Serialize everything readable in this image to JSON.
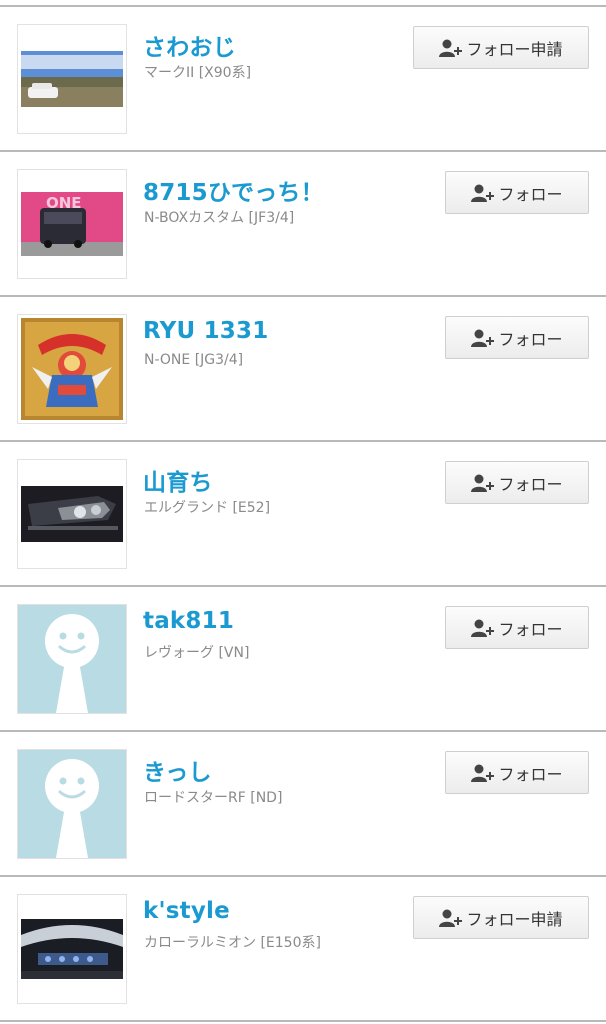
{
  "users": [
    {
      "name": "さわおじ",
      "car": "マークII [X90系]",
      "button": "フォロー申請",
      "avatar_icon": "car-photo-icon"
    },
    {
      "name": "8715ひでっち！",
      "car": "N-BOXカスタム [JF3/4]",
      "button": "フォロー",
      "avatar_icon": "car-photo-icon"
    },
    {
      "name": "RYU 1331",
      "car": "N-ONE [JG3/4]",
      "button": "フォロー",
      "avatar_icon": "sticker-photo-icon"
    },
    {
      "name": "山育ち",
      "car": "エルグランド [E52]",
      "button": "フォロー",
      "avatar_icon": "headlight-photo-icon"
    },
    {
      "name": "tak811",
      "car": "レヴォーグ [VN]",
      "button": "フォロー",
      "avatar_icon": "default-avatar-icon"
    },
    {
      "name": "きっし",
      "car": "ロードスターRF [ND]",
      "button": "フォロー",
      "avatar_icon": "default-avatar-icon"
    },
    {
      "name": "k'style",
      "car": "カローラルミオン [E150系]",
      "button": "フォロー申請",
      "avatar_icon": "interior-photo-icon"
    }
  ],
  "colors": {
    "username": "#1a9ad1",
    "car_text": "#8a8a8a",
    "divider": "#b9b9b9"
  }
}
